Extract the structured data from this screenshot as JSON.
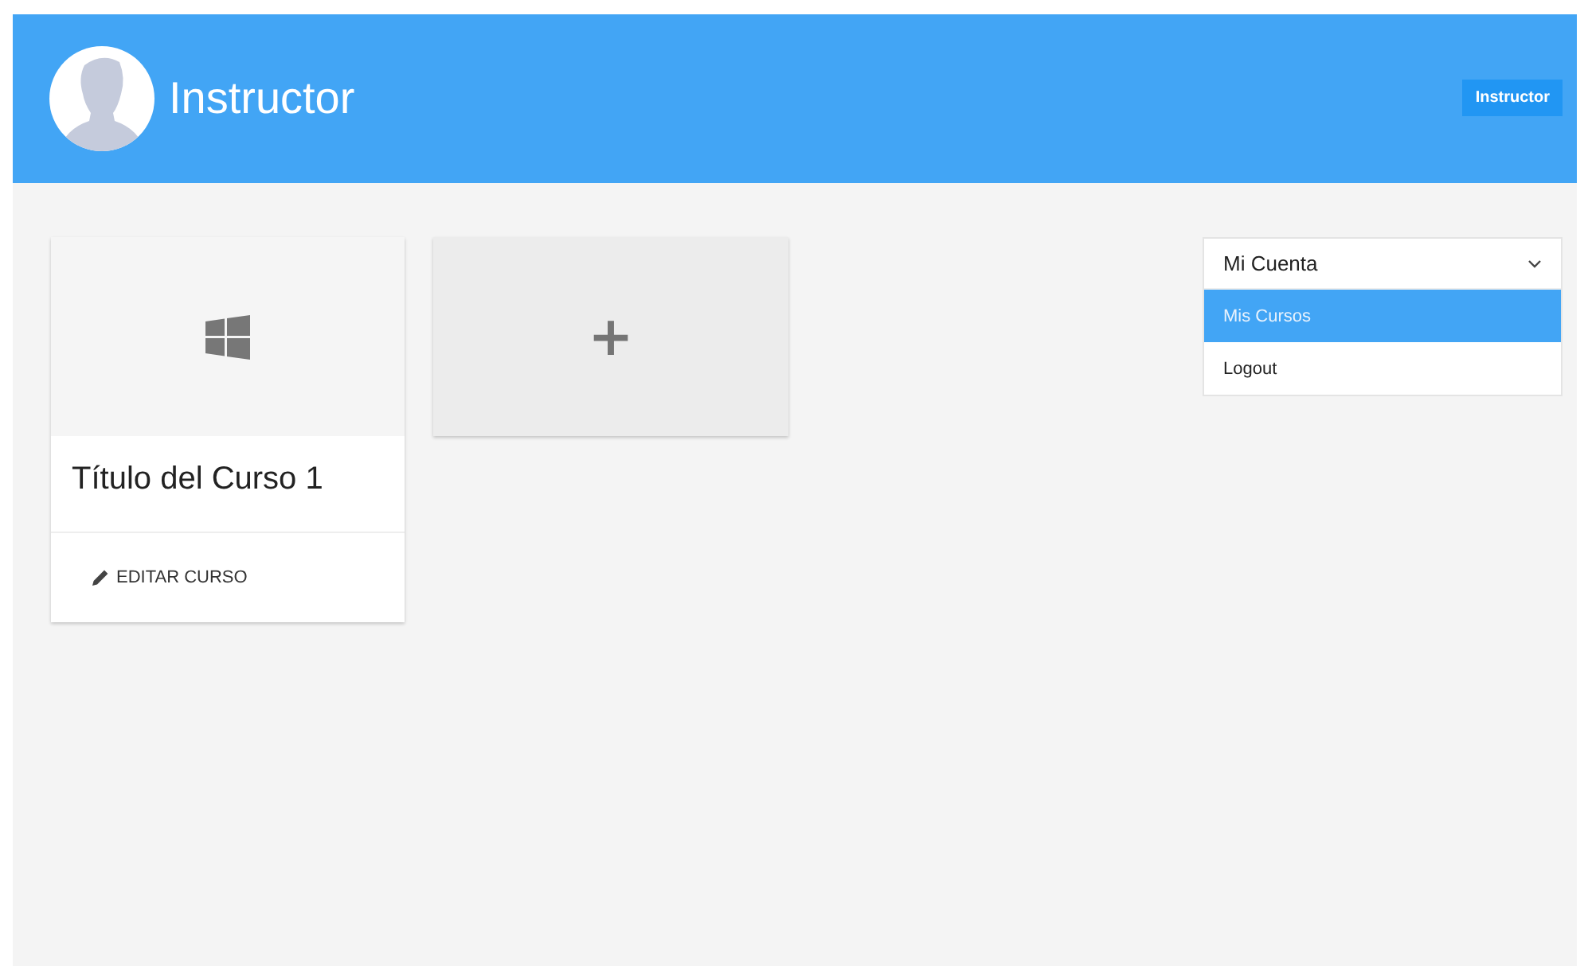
{
  "header": {
    "title": "Instructor",
    "role_button": "Instructor"
  },
  "courses": [
    {
      "title": "Título del Curso 1",
      "action": "EDITAR CURSO"
    }
  ],
  "add_card": {
    "label": "+"
  },
  "account_menu": {
    "title": "Mi Cuenta",
    "expanded": true,
    "items": [
      {
        "label": "Mis Cursos",
        "selected": true
      },
      {
        "label": "Logout",
        "selected": false
      }
    ]
  }
}
